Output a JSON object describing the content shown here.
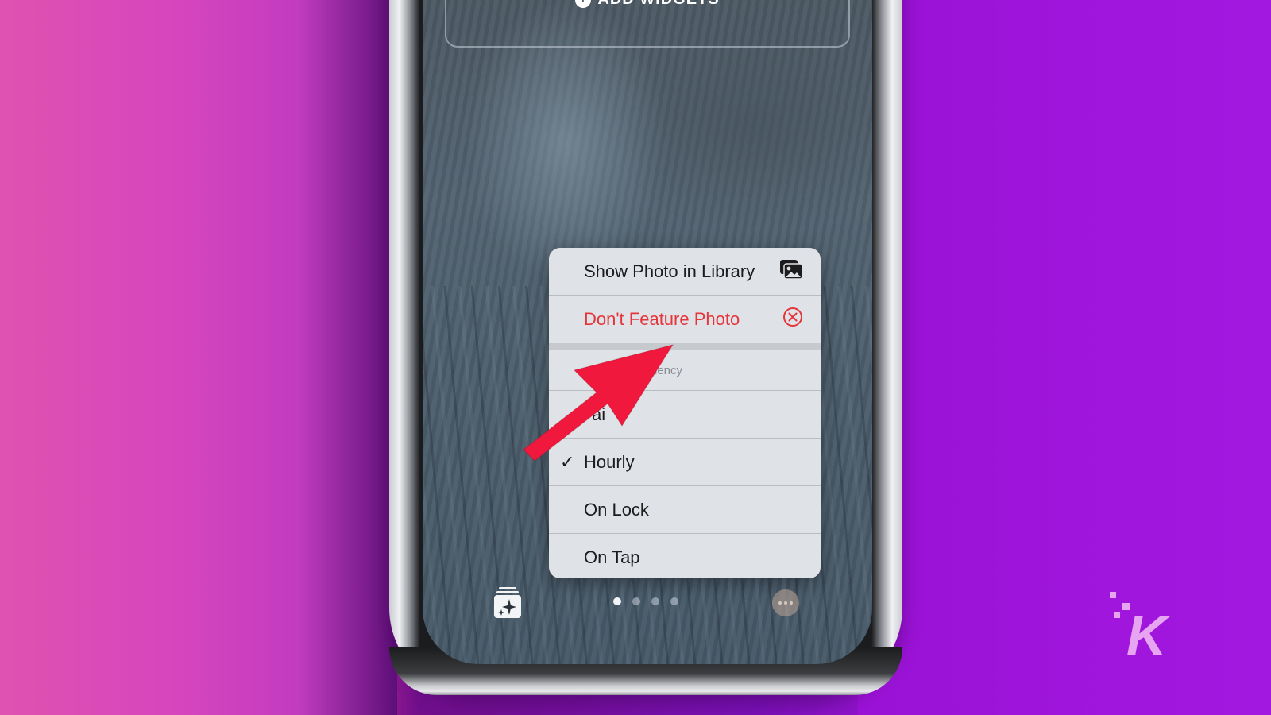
{
  "background": {
    "gradient_colors": [
      "#e052b0",
      "#d443bd",
      "#6f0f8a",
      "#a019dd"
    ]
  },
  "lock_screen": {
    "add_widgets_label": "ADD WIDGETS",
    "page_dots": {
      "count": 4,
      "active_index": 0
    }
  },
  "context_menu": {
    "items": [
      {
        "label": "Show Photo in Library",
        "icon": "photo-library-icon",
        "style": "default"
      },
      {
        "label": "Don't Feature Photo",
        "icon": "x-circle-icon",
        "style": "destructive"
      }
    ],
    "section_header": "Shuffle Frequency",
    "section_header_visible": "uency",
    "options": [
      {
        "label": "Daily",
        "visible_fragment": "ai",
        "checked": false
      },
      {
        "label": "Hourly",
        "checked": true
      },
      {
        "label": "On Lock",
        "checked": false
      },
      {
        "label": "On Tap",
        "checked": false
      }
    ],
    "check_glyph": "✓"
  },
  "annotation": {
    "arrow_color": "#f0193d"
  },
  "watermark": {
    "letter": "K",
    "color": "#e7a4f0"
  },
  "colors": {
    "destructive": "#e5353a",
    "menu_bg": "#dfe2e6"
  }
}
